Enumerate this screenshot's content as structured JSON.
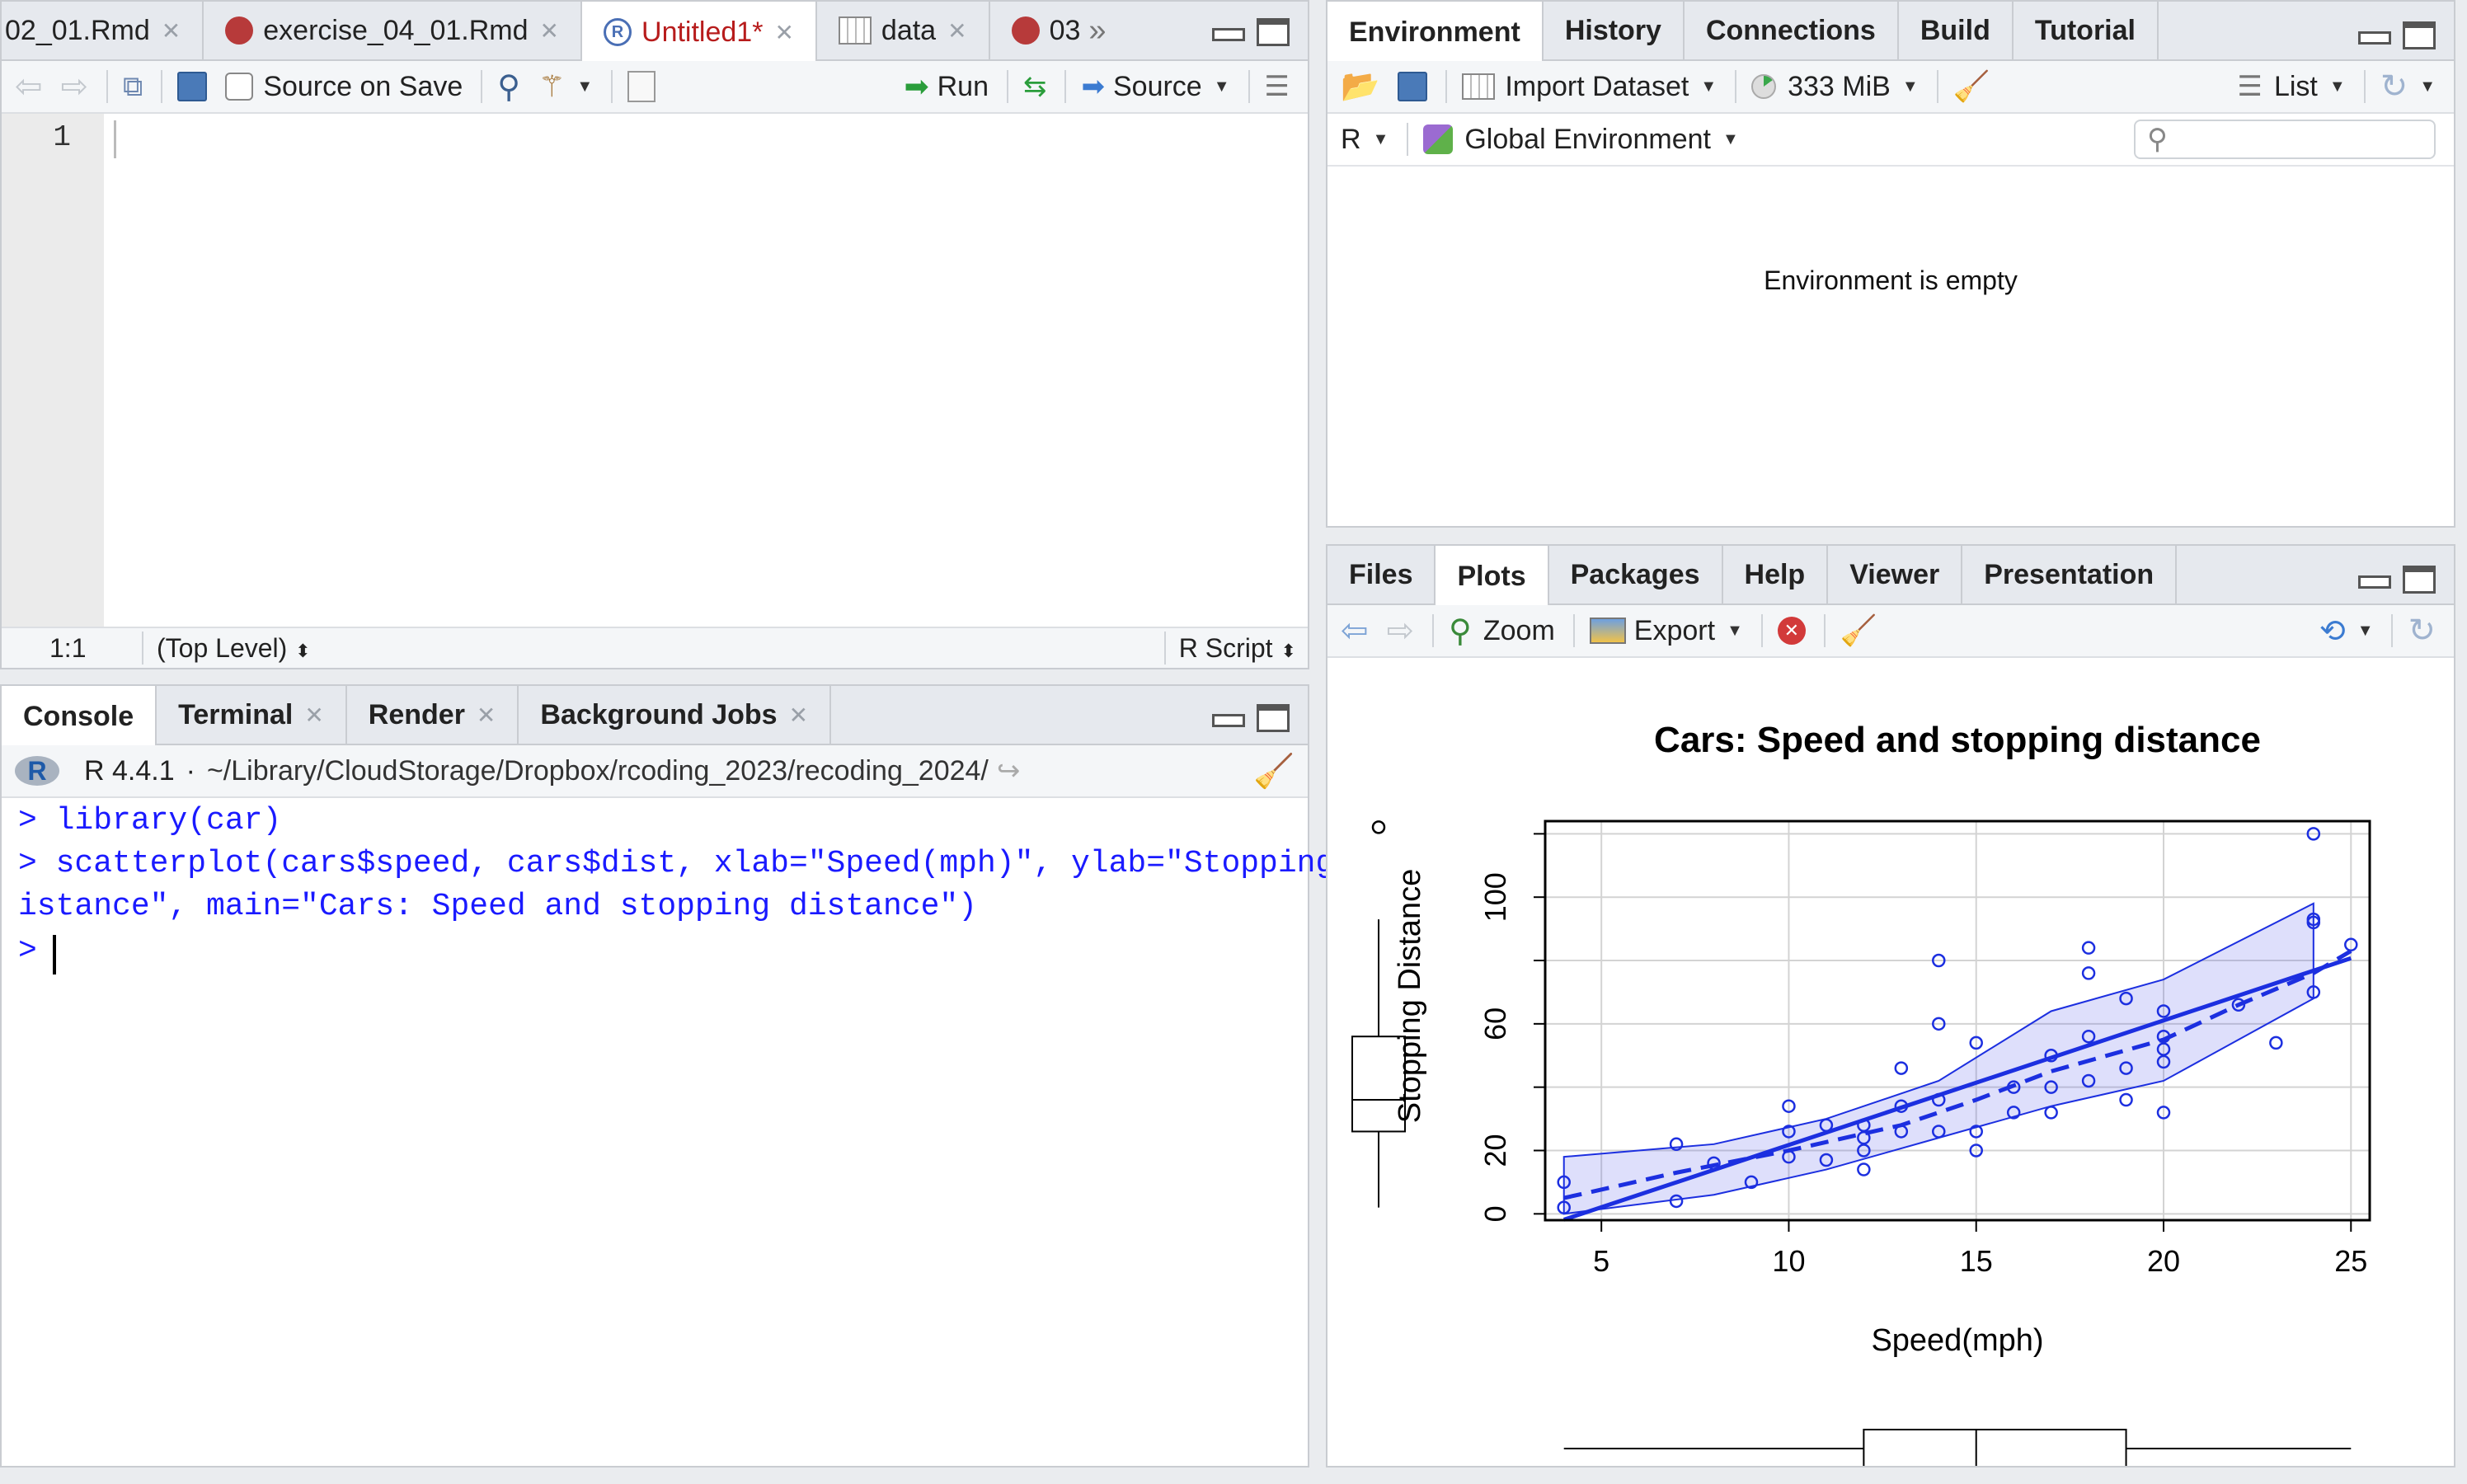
{
  "source_pane": {
    "tabs": [
      {
        "label": "02_01.Rmd",
        "active": false,
        "icon": "rmd-icon"
      },
      {
        "label": "exercise_04_01.Rmd",
        "active": false,
        "icon": "rmd-icon"
      },
      {
        "label": "Untitled1*",
        "active": true,
        "icon": "r-script-icon"
      },
      {
        "label": "data",
        "active": false,
        "icon": "table-icon"
      },
      {
        "label": "03",
        "active": false,
        "icon": "rmd-icon"
      }
    ],
    "toolbar": {
      "source_on_save": "Source on Save",
      "run": "Run",
      "source": "Source"
    },
    "line_number": "1",
    "status": {
      "position": "1:1",
      "scope": "(Top Level)",
      "type": "R Script"
    }
  },
  "console_pane": {
    "tabs": [
      "Console",
      "Terminal",
      "Render",
      "Background Jobs"
    ],
    "r_version": "R 4.4.1",
    "path": "~/Library/CloudStorage/Dropbox/rcoding_2023/recoding_2024/",
    "lines": [
      "> library(car)",
      "> scatterplot(cars$speed, cars$dist, xlab=\"Speed(mph)\", ylab=\"Stopping D",
      "istance\", main=\"Cars: Speed and stopping distance\")",
      "> "
    ]
  },
  "env_pane": {
    "tabs": [
      "Environment",
      "History",
      "Connections",
      "Build",
      "Tutorial"
    ],
    "toolbar": {
      "import": "Import Dataset",
      "memory": "333 MiB",
      "view": "List"
    },
    "lang": "R",
    "scope": "Global Environment",
    "search_placeholder": "",
    "empty_message": "Environment is empty"
  },
  "files_pane": {
    "tabs": [
      "Files",
      "Plots",
      "Packages",
      "Help",
      "Viewer",
      "Presentation"
    ],
    "toolbar": {
      "zoom": "Zoom",
      "export": "Export"
    }
  },
  "chart_data": {
    "type": "scatter",
    "title": "Cars: Speed and stopping distance",
    "xlabel": "Speed(mph)",
    "ylabel": "Stopping Distance",
    "xlim": [
      3.5,
      25.5
    ],
    "ylim": [
      -2,
      124
    ],
    "x_ticks": [
      5,
      10,
      15,
      20,
      25
    ],
    "y_ticks": [
      0,
      20,
      60,
      100
    ],
    "grid": true,
    "color": "#1c2fe0",
    "points": [
      [
        4,
        2
      ],
      [
        4,
        10
      ],
      [
        7,
        4
      ],
      [
        7,
        22
      ],
      [
        8,
        16
      ],
      [
        9,
        10
      ],
      [
        10,
        18
      ],
      [
        10,
        26
      ],
      [
        10,
        34
      ],
      [
        11,
        17
      ],
      [
        11,
        28
      ],
      [
        12,
        14
      ],
      [
        12,
        20
      ],
      [
        12,
        24
      ],
      [
        12,
        28
      ],
      [
        13,
        26
      ],
      [
        13,
        34
      ],
      [
        13,
        46
      ],
      [
        14,
        26
      ],
      [
        14,
        36
      ],
      [
        14,
        60
      ],
      [
        14,
        80
      ],
      [
        15,
        20
      ],
      [
        15,
        26
      ],
      [
        15,
        54
      ],
      [
        16,
        32
      ],
      [
        16,
        40
      ],
      [
        17,
        32
      ],
      [
        17,
        40
      ],
      [
        17,
        50
      ],
      [
        18,
        42
      ],
      [
        18,
        56
      ],
      [
        18,
        76
      ],
      [
        18,
        84
      ],
      [
        19,
        36
      ],
      [
        19,
        46
      ],
      [
        19,
        68
      ],
      [
        20,
        32
      ],
      [
        20,
        48
      ],
      [
        20,
        52
      ],
      [
        20,
        56
      ],
      [
        20,
        64
      ],
      [
        22,
        66
      ],
      [
        23,
        54
      ],
      [
        24,
        70
      ],
      [
        24,
        92
      ],
      [
        24,
        93
      ],
      [
        24,
        120
      ],
      [
        25,
        85
      ]
    ],
    "fit_line": [
      [
        4,
        -1.85
      ],
      [
        25,
        80.73
      ]
    ],
    "smooth_line": [
      [
        4,
        5
      ],
      [
        7,
        13
      ],
      [
        10,
        20
      ],
      [
        13,
        28
      ],
      [
        15,
        36
      ],
      [
        17,
        45
      ],
      [
        20,
        55
      ],
      [
        22,
        66
      ],
      [
        24,
        76
      ],
      [
        25,
        83
      ]
    ],
    "band_upper": [
      [
        4,
        18
      ],
      [
        8,
        22
      ],
      [
        11,
        30
      ],
      [
        14,
        42
      ],
      [
        17,
        64
      ],
      [
        20,
        74
      ],
      [
        24,
        98
      ]
    ],
    "band_lower": [
      [
        4,
        0
      ],
      [
        8,
        6
      ],
      [
        11,
        14
      ],
      [
        14,
        24
      ],
      [
        17,
        34
      ],
      [
        20,
        42
      ],
      [
        24,
        68
      ]
    ],
    "x_box": {
      "min": 4,
      "q1": 12,
      "median": 15,
      "q3": 19,
      "max": 25
    },
    "y_box": {
      "min": 2,
      "q1": 26,
      "median": 36,
      "q3": 56,
      "max": 93,
      "outlier": 120
    }
  }
}
